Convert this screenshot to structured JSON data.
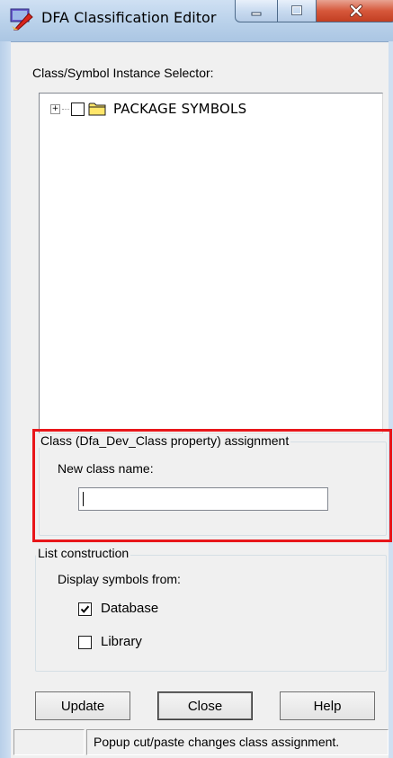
{
  "window": {
    "title": "DFA Classification Editor",
    "icon": "dfa-app-icon"
  },
  "selector": {
    "label": "Class/Symbol Instance Selector:",
    "tree": [
      {
        "label": "PACKAGE SYMBOLS",
        "expanded": false,
        "checked": false,
        "icon": "folder-icon"
      }
    ]
  },
  "class_assignment": {
    "title": "Class (Dfa_Dev_Class property) assignment",
    "new_class_label": "New class name:",
    "new_class_value": ""
  },
  "list_construction": {
    "title": "List construction",
    "display_label": "Display symbols from:",
    "options": [
      {
        "label": "Database",
        "checked": true
      },
      {
        "label": "Library",
        "checked": false
      }
    ]
  },
  "buttons": {
    "update": "Update",
    "close": "Close",
    "help": "Help"
  },
  "status": {
    "message": "Popup cut/paste changes class assignment."
  },
  "colors": {
    "highlight": "#e8161a",
    "folder": "#ffe66a"
  }
}
